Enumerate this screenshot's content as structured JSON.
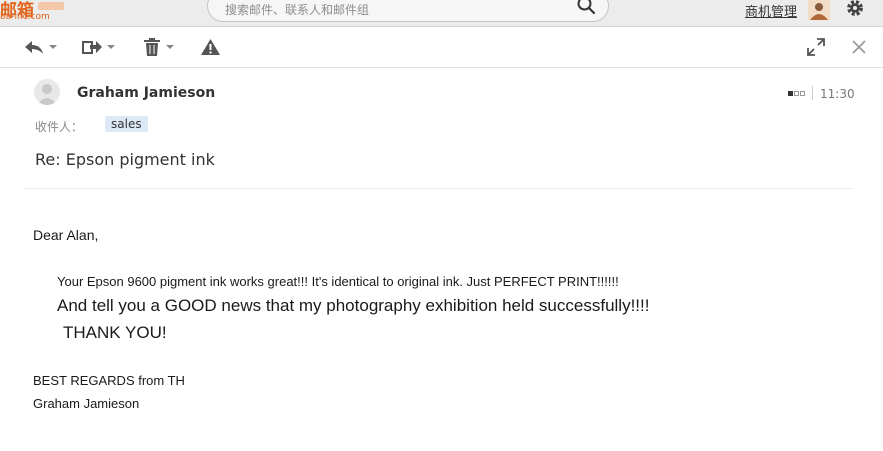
{
  "app": {
    "logo_text": "邮箱",
    "logo_domain": "ba-inc.com",
    "search_placeholder": "搜索邮件、联系人和邮件组",
    "business_link": "商机管理"
  },
  "toolbar": {
    "icons": [
      "reply-icon",
      "forward-icon",
      "trash-icon",
      "report-icon",
      "expand-icon",
      "close-icon"
    ]
  },
  "email": {
    "sender": "Graham Jamieson",
    "recipient_label": "收件人：",
    "recipient": "sales",
    "time": "11:30",
    "subject": "Re: Epson pigment ink",
    "greeting": "Dear Alan,",
    "line1": "Your Epson 9600 pigment ink works great!!! It's identical to original ink. Just PERFECT PRINT!!!!!!",
    "line2": "And tell you a GOOD news that my photography exhibition held successfully!!!!",
    "line3": "THANK YOU!",
    "closing": "BEST REGARDS from TH",
    "signature": "Graham Jamieson"
  },
  "colors": {
    "brand": "#e1661e",
    "recipient_chip": "#dce8f5",
    "toolbar_icon": "#555555"
  }
}
